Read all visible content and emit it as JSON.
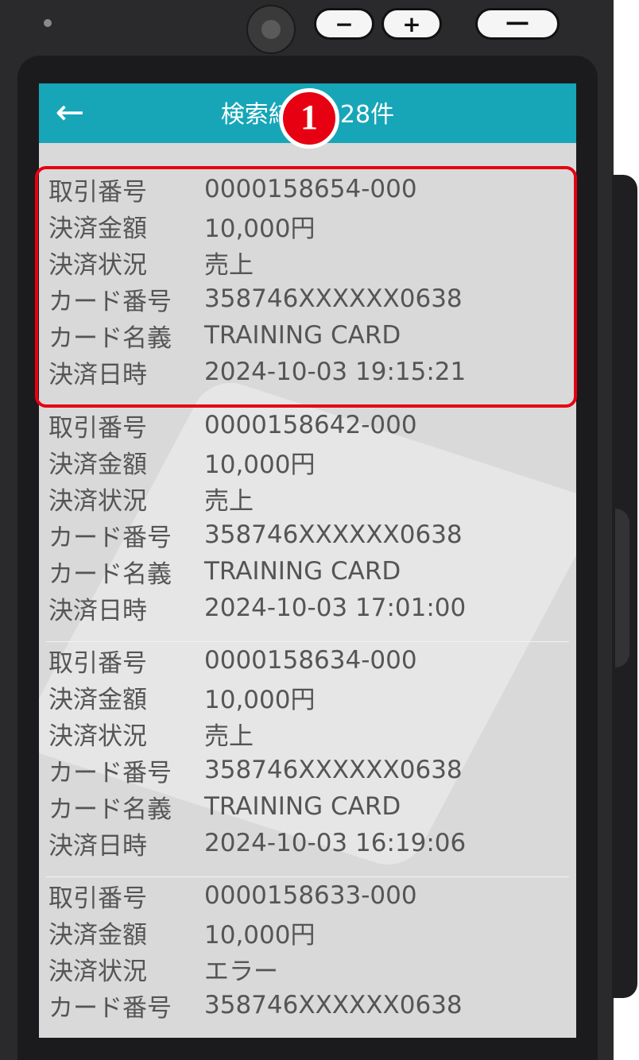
{
  "device": {
    "volume_down": "−",
    "volume_up": "+",
    "side_button": "━━"
  },
  "appbar": {
    "back_icon": "←",
    "title": "検索結果：28件"
  },
  "labels": {
    "transaction_no": "取引番号",
    "amount": "決済金額",
    "status": "決済状況",
    "card_no": "カード番号",
    "card_holder": "カード名義",
    "datetime": "決済日時"
  },
  "records": [
    {
      "transaction_no": "0000158654-000",
      "amount": "10,000円",
      "status": "売上",
      "card_no": "358746XXXXXX0638",
      "card_holder": "TRAINING CARD",
      "datetime": "2024-10-03 19:15:21"
    },
    {
      "transaction_no": "0000158642-000",
      "amount": "10,000円",
      "status": "売上",
      "card_no": "358746XXXXXX0638",
      "card_holder": "TRAINING CARD",
      "datetime": "2024-10-03 17:01:00"
    },
    {
      "transaction_no": "0000158634-000",
      "amount": "10,000円",
      "status": "売上",
      "card_no": "358746XXXXXX0638",
      "card_holder": "TRAINING CARD",
      "datetime": "2024-10-03 16:19:06"
    },
    {
      "transaction_no": "0000158633-000",
      "amount": "10,000円",
      "status": "エラー",
      "card_no": "358746XXXXXX0638"
    }
  ],
  "annotation": {
    "marker": "1",
    "highlight_color": "#e60012"
  },
  "colors": {
    "appbar": "#16a6b8",
    "list_background": "#d9d9d9",
    "text": "#555555"
  }
}
